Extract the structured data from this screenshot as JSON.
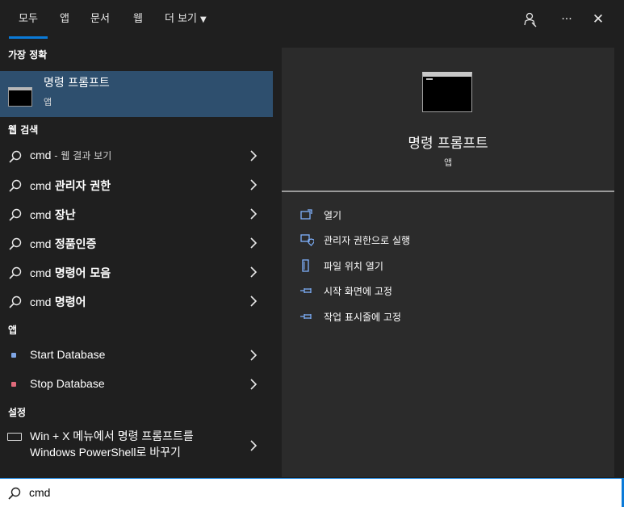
{
  "tabs": [
    {
      "label": "모두",
      "active": true
    },
    {
      "label": "앱"
    },
    {
      "label": "문서"
    },
    {
      "label": "웹"
    },
    {
      "label": "더 보기"
    }
  ],
  "top_icons": [
    "feedback-icon",
    "more-icon",
    "close-icon"
  ],
  "more_glyph": "···",
  "close_glyph": "✕",
  "sections": {
    "best_match": "가장 정확",
    "web_search": "웹 검색",
    "apps": "앱",
    "settings": "설정"
  },
  "best_match": {
    "title": "명령 프롬프트",
    "subtitle": "앱"
  },
  "web_results": [
    {
      "query": "cmd",
      "suffix": "웹 결과 보기",
      "sep": " - "
    },
    {
      "query": "cmd",
      "suffix": "관리자 권한"
    },
    {
      "query": "cmd",
      "suffix": "장난"
    },
    {
      "query": "cmd",
      "suffix": "정품인증"
    },
    {
      "query": "cmd",
      "suffix": "명령어 모음"
    },
    {
      "query": "cmd",
      "suffix": "명령어"
    }
  ],
  "apps": [
    {
      "label": "Start Database",
      "dot_color": "#7fa6e6"
    },
    {
      "label": "Stop Database",
      "dot_color": "#e06a7a"
    }
  ],
  "setting": {
    "line1": "Win + X 메뉴에서 명령 프롬프트를",
    "line2": "Windows PowerShell로 바꾸기"
  },
  "preview": {
    "title": "명령 프롬프트",
    "subtitle": "앱",
    "actions": [
      {
        "label": "열기",
        "icon": "open-icon"
      },
      {
        "label": "관리자 권한으로 실행",
        "icon": "shield-icon"
      },
      {
        "label": "파일 위치 열기",
        "icon": "file-location-icon"
      },
      {
        "label": "시작 화면에 고정",
        "icon": "pin-icon"
      },
      {
        "label": "작업 표시줄에 고정",
        "icon": "pin-icon"
      }
    ]
  },
  "search": {
    "value": "cmd"
  },
  "colors": {
    "accent": "#0a7ad8",
    "selected": "#2e4f6e",
    "panel": "#2b2b2b",
    "bg": "#1f1f1f"
  }
}
